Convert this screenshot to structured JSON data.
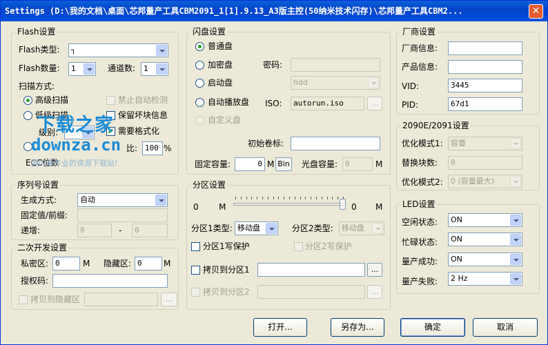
{
  "window": {
    "title": "Settings (D:\\我的文档\\桌面\\芯邦量产工具CBM2091_1[1].9.13_A3版主控(50纳米技术闪存)\\芯邦量产工具CBM2...",
    "close": "✕"
  },
  "flash": {
    "group": "Flash设置",
    "type_label": "Flash类型:",
    "type_value": "┐",
    "count_label": "Flash数量:",
    "count_value": "1",
    "channel_label": "通道数:",
    "channel_value": "1",
    "scan_label": "扫描方式:",
    "scan_advanced": "高级扫描",
    "auto_detect": "禁止自动检测",
    "low_scan": "低级扫描",
    "bad_block_info": "保留坏块信息",
    "level_label": "级别:",
    "need_format": "需要格式化",
    "ratio_label": "比:",
    "ratio_value": "100",
    "ratio_unit": "%",
    "ecc_label": "ECC位数"
  },
  "udisk": {
    "group": "闪盘设置",
    "normal": "普通盘",
    "encrypted": "加密盘",
    "password_label": "密码:",
    "bootable": "启动盘",
    "boot_value": "hdd",
    "autoplay": "自动播放盘",
    "iso_label": "ISO:",
    "iso_value": "autorun.iso",
    "browse": "...",
    "custom": "自定义盘",
    "volume_label": "初始卷标:",
    "volume_value": "",
    "fixed_cap_label": "固定容量:",
    "fixed_cap_value": "0",
    "unit_m": "M",
    "bin": "Bin",
    "cd_cap_label": "光盘容量:",
    "cd_cap_value": "0"
  },
  "vendor": {
    "group": "厂商设置",
    "info_label": "厂商信息:",
    "info_value": "",
    "product_label": "产品信息:",
    "product_value": "",
    "vid_label": "VID:",
    "vid_value": "3445",
    "pid_label": "PID:",
    "pid_value": "67d1"
  },
  "opt2090": {
    "group": "2090E/2091设置",
    "mode1_label": "优化模式1:",
    "mode1_value": "容量",
    "replace_label": "替换块数:",
    "replace_value": "0",
    "mode2_label": "优化模式2:",
    "mode2_value": "0 (容量最大)"
  },
  "serial": {
    "group": "序列号设置",
    "gen_label": "生成方式:",
    "gen_value": "自动",
    "fixed_label": "固定值/前缀:",
    "fixed_value": "",
    "inc_label": "递增:",
    "inc_from": "0",
    "inc_dash": "-",
    "inc_to": "0"
  },
  "partition": {
    "group": "分区设置",
    "left_val": "0",
    "left_unit": "M",
    "right_val": "0",
    "right_unit": "M",
    "p1_type_label": "分区1类型:",
    "p1_type_value": "移动盘",
    "p2_type_label": "分区2类型:",
    "p2_type_value": "移动盘",
    "p1_wp": "分区1写保护",
    "p2_wp": "分区2写保护",
    "copy_p1": "拷贝到分区1",
    "copy_p2": "拷贝到分区2",
    "browse": "..."
  },
  "dev": {
    "group": "二次开发设置",
    "private_label": "私密区:",
    "private_value": "0",
    "private_unit": "M",
    "hidden_label": "隐藏区:",
    "hidden_value": "0",
    "hidden_unit": "M",
    "auth_label": "授权码:",
    "auth_value": "",
    "copy_hidden": "拷贝到隐藏区",
    "browse": "..."
  },
  "led": {
    "group": "LED设置",
    "idle_label": "空闲状态:",
    "idle_value": "ON",
    "busy_label": "忙碌状态:",
    "busy_value": "ON",
    "success_label": "量产成功:",
    "success_value": "ON",
    "fail_label": "量产失败:",
    "fail_value": "2 Hz"
  },
  "buttons": {
    "open": "打开...",
    "save_as": "另存为...",
    "ok": "确定",
    "cancel": "取消"
  },
  "watermark": {
    "line1": "下载之家",
    "line2": "downza.cn",
    "line3": "国内最专业的资源下载站!"
  }
}
